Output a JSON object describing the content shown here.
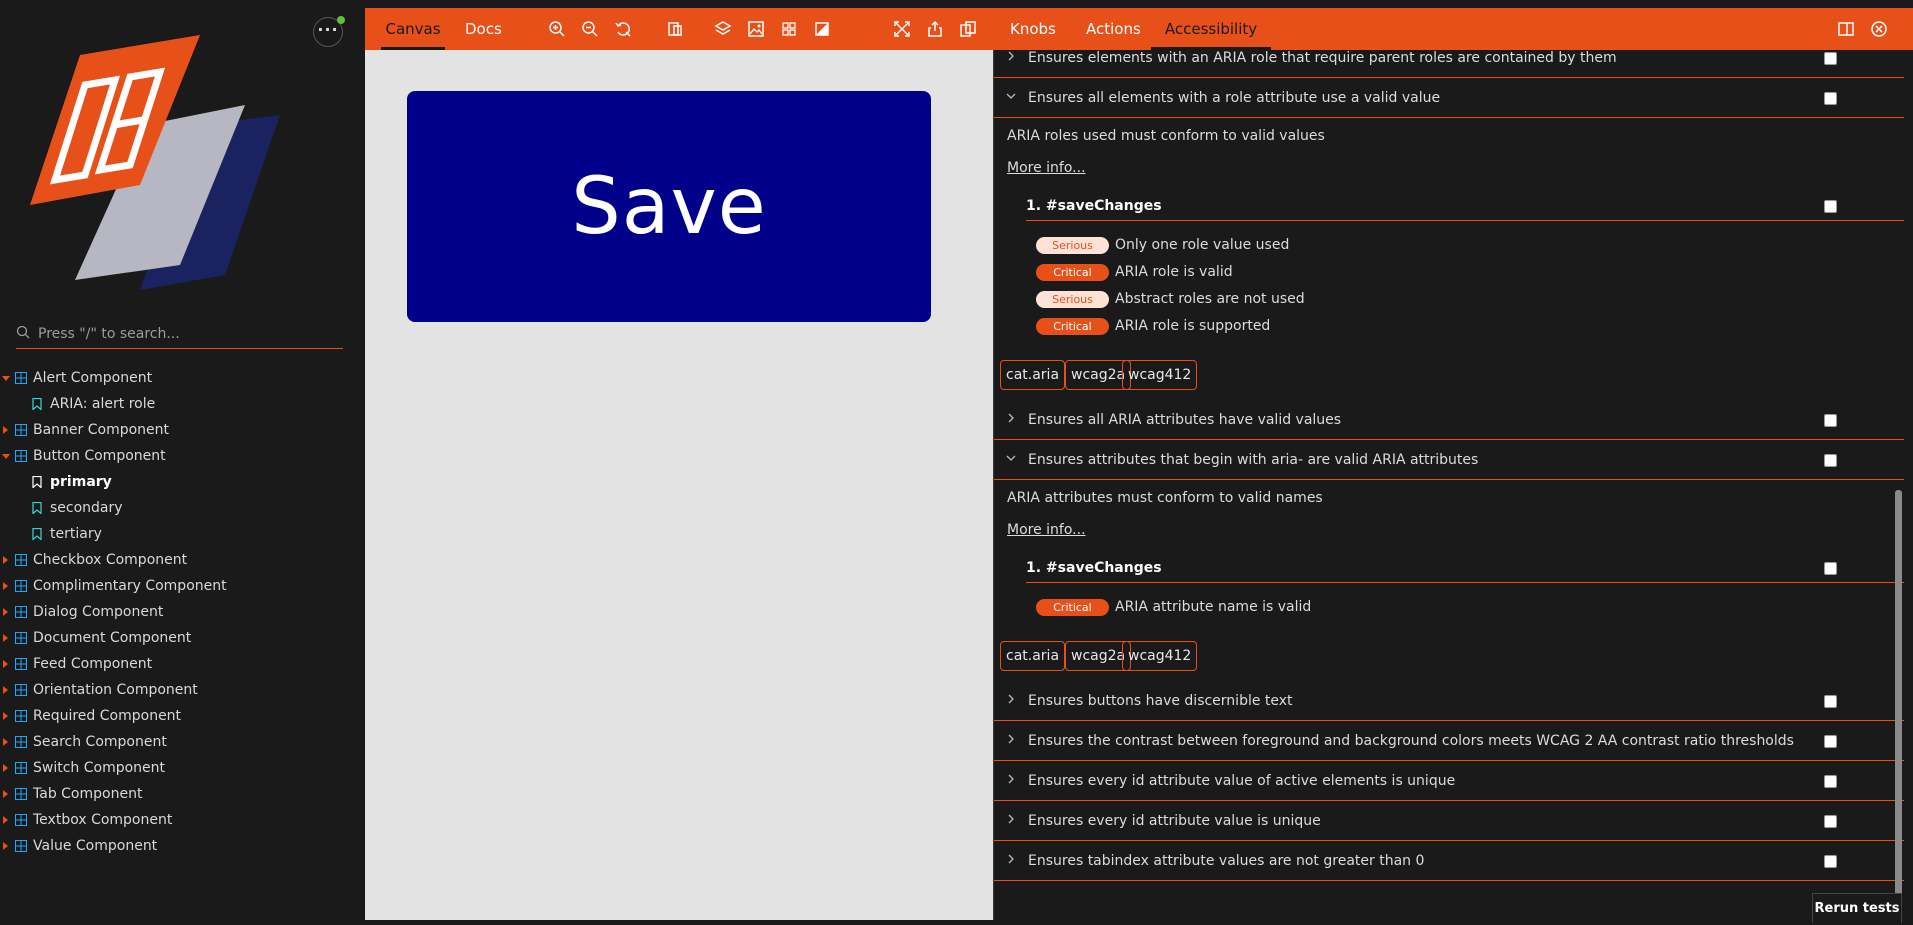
{
  "sidebar": {
    "search": {
      "placeholder": "Press \"/\" to search..."
    },
    "tree": [
      {
        "label": "Alert Component",
        "expanded": true,
        "children": [
          {
            "label": "ARIA: alert role"
          }
        ]
      },
      {
        "label": "Banner Component",
        "expanded": false
      },
      {
        "label": "Button Component",
        "expanded": true,
        "children": [
          {
            "label": "primary",
            "selected": true
          },
          {
            "label": "secondary"
          },
          {
            "label": "tertiary"
          }
        ]
      },
      {
        "label": "Checkbox Component",
        "expanded": false
      },
      {
        "label": "Complimentary Component",
        "expanded": false
      },
      {
        "label": "Dialog Component",
        "expanded": false
      },
      {
        "label": "Document Component",
        "expanded": false
      },
      {
        "label": "Feed Component",
        "expanded": false
      },
      {
        "label": "Orientation Component",
        "expanded": false
      },
      {
        "label": "Required Component",
        "expanded": false
      },
      {
        "label": "Search Component",
        "expanded": false
      },
      {
        "label": "Switch Component",
        "expanded": false
      },
      {
        "label": "Tab Component",
        "expanded": false
      },
      {
        "label": "Textbox Component",
        "expanded": false
      },
      {
        "label": "Value Component",
        "expanded": false
      }
    ]
  },
  "toolbar": {
    "tabs": [
      "Canvas",
      "Docs"
    ],
    "addon_tabs": [
      "Knobs",
      "Actions",
      "Accessibility"
    ],
    "active_tab": "Canvas",
    "active_addon": "Accessibility"
  },
  "canvas": {
    "button_label": "Save"
  },
  "a11y": {
    "rules": [
      {
        "title": "Ensures elements with an ARIA role that require parent roles are contained by them",
        "expanded": false
      },
      {
        "title": "Ensures all elements with a role attribute use a valid value",
        "expanded": true,
        "description": "ARIA roles used must conform to valid values",
        "more_info": "More info...",
        "node": "1. #saveChanges",
        "checks": [
          {
            "severity": "Serious",
            "text": "Only one role value used"
          },
          {
            "severity": "Critical",
            "text": "ARIA role is valid"
          },
          {
            "severity": "Serious",
            "text": "Abstract roles are not used"
          },
          {
            "severity": "Critical",
            "text": "ARIA role is supported"
          }
        ],
        "tags": [
          "cat.aria",
          "wcag2a",
          "wcag412"
        ]
      },
      {
        "title": "Ensures all ARIA attributes have valid values",
        "expanded": false
      },
      {
        "title": "Ensures attributes that begin with aria- are valid ARIA attributes",
        "expanded": true,
        "description": "ARIA attributes must conform to valid names",
        "more_info": "More info...",
        "node": "1. #saveChanges",
        "checks": [
          {
            "severity": "Critical",
            "text": "ARIA attribute name is valid"
          }
        ],
        "tags": [
          "cat.aria",
          "wcag2a",
          "wcag412"
        ]
      },
      {
        "title": "Ensures buttons have discernible text",
        "expanded": false
      },
      {
        "title": "Ensures the contrast between foreground and background colors meets WCAG 2 AA contrast ratio thresholds",
        "expanded": false
      },
      {
        "title": "Ensures every id attribute value of active elements is unique",
        "expanded": false
      },
      {
        "title": "Ensures every id attribute value is unique",
        "expanded": false
      },
      {
        "title": "Ensures tabindex attribute values are not greater than 0",
        "expanded": false
      }
    ],
    "rerun_label": "Rerun tests"
  },
  "colors": {
    "accent": "#e8501a",
    "background": "#1b1a1a",
    "canvas": "#e3e3e3",
    "preview_button": "#00008b"
  }
}
